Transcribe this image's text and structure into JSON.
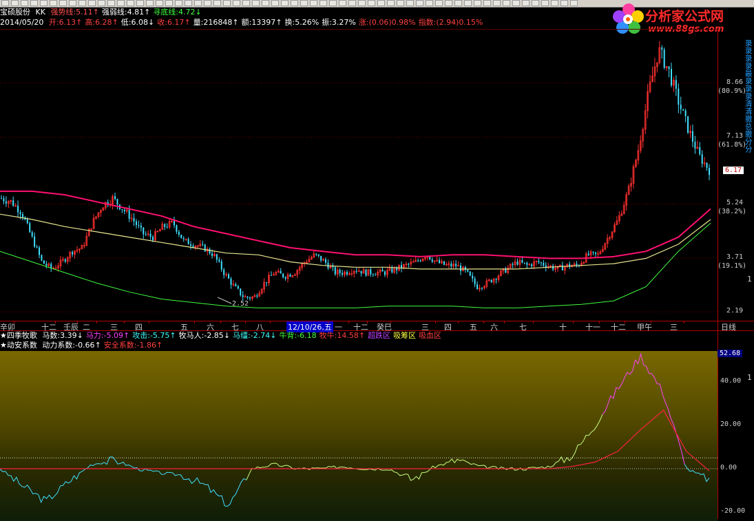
{
  "header": {
    "stock_name": "宝硕股份",
    "indicator": "KK",
    "line1": [
      {
        "label": "强势线",
        "value": "5.11",
        "arrow": "↑",
        "color": "#ff5050"
      },
      {
        "label": "强弱线",
        "value": "4.81",
        "arrow": "↑",
        "color": "#ffffff"
      },
      {
        "label": "寻底线",
        "value": "4.72",
        "arrow": "↓",
        "color": "#40ff40"
      }
    ],
    "date": "2014/05/20",
    "quote": [
      {
        "label": "开",
        "value": "6.13",
        "arrow": "↑",
        "color": "#ff4040"
      },
      {
        "label": "高",
        "value": "6.28",
        "arrow": "↑",
        "color": "#ff4040"
      },
      {
        "label": "低",
        "value": "6.08",
        "arrow": "↓",
        "color": "#ffffff"
      },
      {
        "label": "收",
        "value": "6.17",
        "arrow": "↑",
        "color": "#ff4040"
      },
      {
        "label": "量",
        "value": "216848",
        "arrow": "↑",
        "color": "#ffffff"
      },
      {
        "label": "额",
        "value": "13397",
        "arrow": "↑",
        "color": "#ffffff"
      },
      {
        "label": "换",
        "value": "5.26%",
        "arrow": "",
        "color": "#ffffff"
      },
      {
        "label": "振",
        "value": "3.27%",
        "arrow": "",
        "color": "#ffffff"
      },
      {
        "label": "涨",
        "value": "(0.06)0.98%",
        "arrow": "",
        "color": "#ff4040"
      },
      {
        "label": "指数",
        "value": "(2.94)0.15%",
        "arrow": "",
        "color": "#ff4040"
      }
    ]
  },
  "brand": {
    "name": "分析家公式网",
    "url": "www.88gs.com"
  },
  "side_strip_text": "录录录录最录录录清清撤总撤分分",
  "price_axis": [
    {
      "value": "8.66",
      "pct": "(80.9%)"
    },
    {
      "value": "7.13",
      "pct": "(61.8%)"
    },
    {
      "value": "6.17",
      "pct": ""
    },
    {
      "value": "5.24",
      "pct": "(38.2%)"
    },
    {
      "value": "3.71",
      "pct": "(19.1%)"
    },
    {
      "value": "2.19",
      "pct": ""
    }
  ],
  "low_marker": "2.52",
  "right_edge_numbers": [
    "1",
    "1"
  ],
  "time_axis": {
    "labels": [
      "辛卯",
      "十二",
      "壬辰",
      "二",
      "三",
      "四",
      "五",
      "六",
      "七",
      "八",
      "12/10/26,五",
      "一",
      "十二",
      "癸巳",
      "三",
      "四",
      "五",
      "六",
      "七",
      "十",
      "十一",
      "十二",
      "甲午",
      "三"
    ],
    "highlight": "12/10/26,五",
    "period": "日线"
  },
  "indicator1": {
    "name": "★四季牧歌",
    "items": [
      {
        "label": "马数",
        "value": "3.39",
        "arrow": "↓",
        "color": "#ffffff"
      },
      {
        "label": "马力",
        "value": "-5.09",
        "arrow": "↑",
        "color": "#ff40ff"
      },
      {
        "label": "攻击",
        "value": "-5.75",
        "arrow": "↑",
        "color": "#40ffff"
      },
      {
        "label": "牧马人",
        "value": "-2.85",
        "arrow": "↓",
        "color": "#ffffff"
      },
      {
        "label": "马缰",
        "value": "-2.74",
        "arrow": "↓",
        "color": "#40ffff"
      },
      {
        "label": "牛背",
        "value": "-6.18",
        "arrow": "",
        "color": "#40ff40"
      },
      {
        "label": "牧牛",
        "value": "14.58",
        "arrow": "↑",
        "color": "#ff4040"
      },
      {
        "label": "超跌区",
        "value": "",
        "arrow": "",
        "color": "#c040ff"
      },
      {
        "label": "吸筹区",
        "value": "",
        "arrow": "",
        "color": "#ffff40"
      },
      {
        "label": "吸血区",
        "value": "",
        "arrow": "",
        "color": "#ff4040"
      }
    ]
  },
  "indicator2": {
    "name": "★动安系数",
    "items": [
      {
        "label": "动力系数",
        "value": "-0.66",
        "arrow": "↑",
        "color": "#ffffff"
      },
      {
        "label": "安全系数",
        "value": "-1.86",
        "arrow": "↑",
        "color": "#ff4040"
      }
    ],
    "axis": [
      "52.68",
      "40.00",
      "20.00",
      "0.00",
      "-20.00"
    ]
  },
  "colors": {
    "up": "#ff3030",
    "down": "#40e0ff",
    "ma_strong": "#ff1070",
    "ma_mid": "#e8e890",
    "ma_low": "#40ff40",
    "grid": "#800000"
  },
  "chart_data": {
    "type": "candlestick",
    "period": "日线",
    "ylim": [
      2.19,
      9.9
    ],
    "price_ticks": [
      8.66,
      7.13,
      5.24,
      3.71,
      2.19
    ],
    "last_close": 6.17,
    "low": 2.52,
    "approx_close_path": [
      5.4,
      5.3,
      5.0,
      4.3,
      3.6,
      3.4,
      3.6,
      3.9,
      4.0,
      4.7,
      5.2,
      5.4,
      5.1,
      4.8,
      4.4,
      4.3,
      4.6,
      4.7,
      4.2,
      4.1,
      4.0,
      3.8,
      3.3,
      2.9,
      2.6,
      2.6,
      3.0,
      3.3,
      3.2,
      3.3,
      3.6,
      3.8,
      3.6,
      3.3,
      3.3,
      3.4,
      3.3,
      3.3,
      3.3,
      3.4,
      3.5,
      3.6,
      3.8,
      3.6,
      3.5,
      3.5,
      3.3,
      2.9,
      3.0,
      3.2,
      3.4,
      3.6,
      3.5,
      3.6,
      3.5,
      3.4,
      3.5,
      3.5,
      3.8,
      3.8,
      4.3,
      4.8,
      5.6,
      6.8,
      8.4,
      9.6,
      9.0,
      8.1,
      7.3,
      6.6,
      6.2
    ],
    "ma_strong": [
      5.6,
      5.6,
      5.5,
      5.3,
      5.1,
      4.9,
      4.6,
      4.4,
      4.2,
      4.0,
      3.9,
      3.8,
      3.8,
      3.75,
      3.8,
      3.8,
      3.75,
      3.7,
      3.7,
      3.75,
      3.9,
      4.3,
      5.1
    ],
    "ma_mid": [
      4.95,
      4.8,
      4.6,
      4.45,
      4.3,
      4.15,
      4.0,
      3.85,
      3.8,
      3.6,
      3.5,
      3.45,
      3.45,
      3.4,
      3.4,
      3.4,
      3.4,
      3.45,
      3.5,
      3.55,
      3.7,
      4.1,
      4.8
    ],
    "ma_low": [
      3.9,
      3.6,
      3.3,
      3.0,
      2.75,
      2.55,
      2.45,
      2.35,
      2.3,
      2.3,
      2.3,
      2.3,
      2.35,
      2.35,
      2.35,
      2.3,
      2.3,
      2.35,
      2.4,
      2.5,
      2.9,
      3.9,
      4.7
    ],
    "sub_series": [
      {
        "name": "动力系数",
        "values": [
          0,
          -8,
          -15,
          -6,
          2,
          4,
          0,
          -2,
          -3,
          -8,
          -17,
          0,
          2,
          0,
          0,
          1,
          0,
          0,
          -5,
          1,
          4,
          1,
          0,
          0,
          1,
          6,
          20,
          37,
          52,
          35,
          0,
          -5
        ]
      },
      {
        "name": "安全系数",
        "values": [
          0,
          0,
          0,
          0,
          0,
          0,
          0,
          0,
          0,
          0,
          0,
          0,
          0,
          0,
          0,
          0,
          0,
          0,
          0,
          0,
          0,
          0,
          0,
          0,
          0,
          1,
          3,
          8,
          18,
          27,
          8,
          -1
        ]
      }
    ],
    "sub_ylim": [
      -20,
      52.68
    ]
  }
}
